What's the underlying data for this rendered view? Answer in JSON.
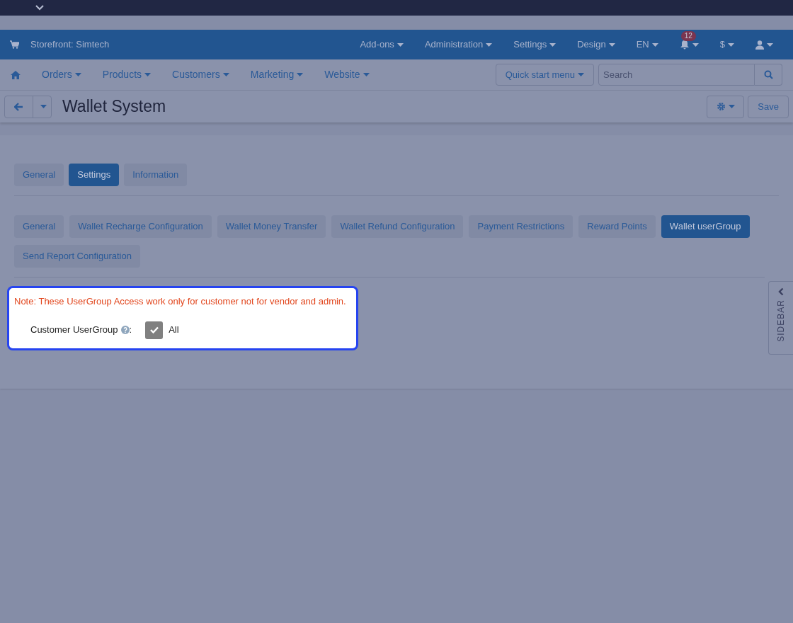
{
  "header": {
    "storefront": "Storefront: Simtech",
    "menus": [
      "Add-ons",
      "Administration",
      "Settings",
      "Design",
      "EN"
    ],
    "notifications": "12",
    "currency": "$"
  },
  "nav": {
    "items": [
      "Orders",
      "Products",
      "Customers",
      "Marketing",
      "Website"
    ],
    "quick_start": "Quick start menu",
    "search": {
      "placeholder": "Search"
    }
  },
  "page": {
    "title": "Wallet System",
    "save": "Save"
  },
  "tabs": [
    {
      "label": "General",
      "selected": false
    },
    {
      "label": "Settings",
      "selected": true
    },
    {
      "label": "Information",
      "selected": false
    }
  ],
  "subtabs": [
    {
      "label": "General",
      "selected": false
    },
    {
      "label": "Wallet Recharge Configuration",
      "selected": false
    },
    {
      "label": "Wallet Money Transfer",
      "selected": false
    },
    {
      "label": "Wallet Refund Configuration",
      "selected": false
    },
    {
      "label": "Payment Restrictions",
      "selected": false
    },
    {
      "label": "Reward Points",
      "selected": false
    },
    {
      "label": "Wallet userGroup",
      "selected": true
    },
    {
      "label": "Send Report Configuration",
      "selected": false
    }
  ],
  "panel": {
    "note": "Note: These UserGroup Access work only for customer not for vendor and admin.",
    "field_label": "Customer UserGroup",
    "colon": ":",
    "option": {
      "label": "All",
      "checked": true
    }
  },
  "sidebar_tab": "SIDEBAR"
}
